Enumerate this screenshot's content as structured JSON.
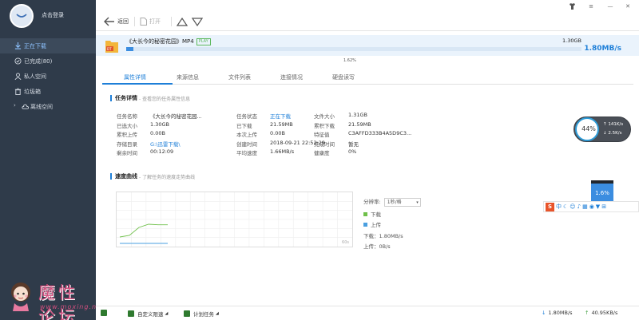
{
  "sidebar": {
    "login": "点击登录",
    "items": [
      {
        "label": "正在下载",
        "icon": "download-icon"
      },
      {
        "label": "已完成(80)",
        "icon": "check-circle-icon"
      },
      {
        "label": "私人空间",
        "icon": "user-icon"
      },
      {
        "label": "垃圾箱",
        "icon": "trash-icon"
      },
      {
        "label": "离线空间",
        "icon": "cloud-icon"
      }
    ]
  },
  "watermark": {
    "title": "魔性论坛",
    "url": "www.moxing.net"
  },
  "toolbar": {
    "back": "返回",
    "open": "打开"
  },
  "task": {
    "name": "《大长今的秘密花园》MP4",
    "play": "PLAY",
    "size": "1.30GB",
    "progress_text": "1.62%",
    "progress": 0.0162,
    "speed": "1.80MB/s",
    "folder_badge": "DT"
  },
  "tabs": [
    "属性详情",
    "来源信息",
    "文件列表",
    "连接情况",
    "硬盘读写"
  ],
  "details": {
    "title": "任务详情",
    "subtitle": "- 查看您的任务属性信息",
    "rows": [
      [
        [
          "任务名称",
          "《大长今的秘密花园..."
        ],
        [
          "任务状态",
          "正在下载"
        ],
        [
          "文件大小",
          "1.31GB"
        ]
      ],
      [
        [
          "已选大小",
          "1.30GB"
        ],
        [
          "已下载",
          "21.59MB"
        ],
        [
          "累积下载",
          "21.59MB"
        ]
      ],
      [
        [
          "累积上传",
          "0.00B"
        ],
        [
          "本次上传",
          "0.00B"
        ],
        [
          "特征值",
          "C3AFFD333B4A5D9C3..."
        ]
      ],
      [
        [
          "存储目录",
          "G:\\迅雷下载\\"
        ],
        [
          "创建时间",
          "2018-09-21 22:52:29"
        ],
        [
          "完成时间",
          "暂无"
        ]
      ],
      [
        [
          "剩余时间",
          "00:12:09"
        ],
        [
          "平均速度",
          "1.66MB/s"
        ],
        [
          "健康度",
          "0%"
        ]
      ]
    ]
  },
  "speed_curve": {
    "title": "速度曲线",
    "subtitle": "- 了解任务的速度走势曲线",
    "granularity_label": "分辨率:",
    "granularity_value": "1秒/格",
    "legend": [
      {
        "label": "下载",
        "color": "#6fc04a"
      },
      {
        "label": "上传",
        "color": "#4a9fe0"
      }
    ],
    "down_text": "下载：1.80MB/s",
    "up_text": "上传：0B/s",
    "corner_label": "60s"
  },
  "chart_data": {
    "type": "line",
    "series": [
      {
        "name": "下载",
        "values": [
          0.6,
          0.75,
          1.5,
          1.8,
          1.75,
          1.75
        ]
      },
      {
        "name": "上传",
        "values": [
          0,
          0,
          0,
          0,
          0,
          0
        ]
      }
    ],
    "x": [
      0,
      1,
      2,
      3,
      4,
      5
    ]
  },
  "statusbar": {
    "custom_speed": "自定义限速",
    "plan": "计划任务",
    "down_speed": "1.80MB/s",
    "up_speed": "40.95KB/s"
  },
  "gauge": {
    "percent": "44%",
    "value": 0.44,
    "up": "141K/s",
    "down": "2.5K/s"
  },
  "mini_meter": {
    "text": "1.6%",
    "value": 0.016
  },
  "ime": {
    "brand": "S",
    "mode": "中"
  }
}
